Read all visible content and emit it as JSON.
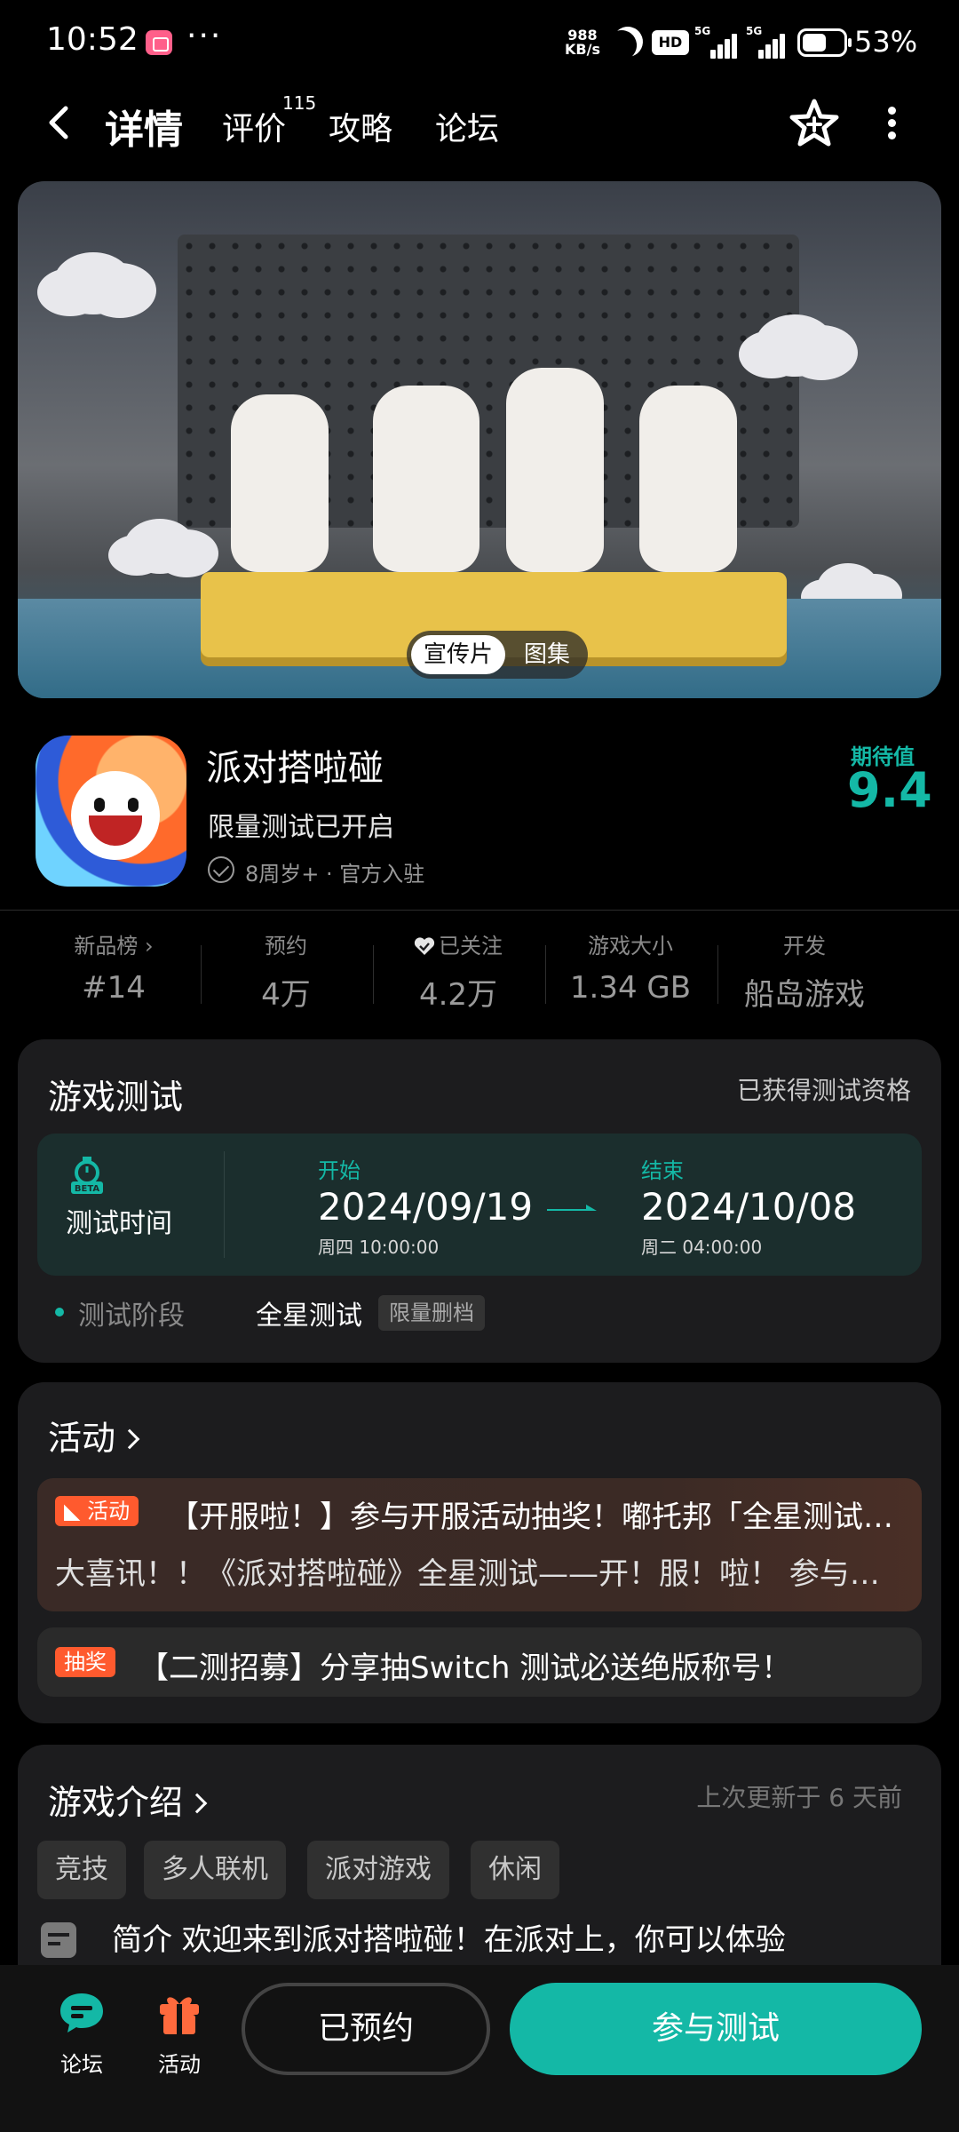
{
  "status_bar": {
    "time": "10:52",
    "dots": "···",
    "net_speed_value": "988",
    "net_speed_unit": "KB/s",
    "hd_label": "HD",
    "sim1_label": "5G",
    "sim2_label": "5G",
    "battery_percent": "53%"
  },
  "nav": {
    "tabs": [
      {
        "label": "详情"
      },
      {
        "label": "评价"
      },
      {
        "label": "攻略"
      },
      {
        "label": "论坛"
      }
    ],
    "review_count": "115"
  },
  "media": {
    "options": [
      "宣传片",
      "图集"
    ]
  },
  "game": {
    "title": "派对搭啦碰",
    "status": "限量测试已开启",
    "meta": "8周岁+ · 官方入驻",
    "expect_label": "期待值",
    "expect_value": "9.4"
  },
  "stats": [
    {
      "label": "新品榜 ›",
      "value": "#14"
    },
    {
      "label": "预约",
      "value": "4万"
    },
    {
      "label": "已关注",
      "value": "4.2万"
    },
    {
      "label": "游戏大小",
      "value": "1.34 GB"
    },
    {
      "label": "开发",
      "value": "船岛游戏"
    }
  ],
  "test_card": {
    "title": "游戏测试",
    "qualification": "已获得测试资格",
    "time_label": "测试时间",
    "beta_label": "BETA",
    "start_label": "开始",
    "start_date": "2024/09/19",
    "start_time": "周四 10:00:00",
    "end_label": "结束",
    "end_date": "2024/10/08",
    "end_time": "周二 04:00:00",
    "stage_label": "测试阶段",
    "stage_value": "全星测试",
    "stage_tag": "限量删档"
  },
  "activity_card": {
    "title": "活动",
    "items": [
      {
        "tag": "活动",
        "title": "【开服啦！】参与开服活动抽奖！嘟托邦「全星测试」开启...",
        "desc": "大喜讯！！《派对搭啦碰》全星测试——开！服！啦！ 参与开服活动..."
      },
      {
        "tag": "抽奖",
        "title": "【二测招募】分享抽Switch 测试必送绝版称号！"
      }
    ]
  },
  "intro_card": {
    "title": "游戏介绍",
    "updated": "上次更新于 6 天前",
    "tags": [
      "竞技",
      "多人联机",
      "派对游戏",
      "休闲"
    ],
    "intro_text": "简介 欢迎来到派对搭啦碰！在派对上，你可以体验"
  },
  "bottom_bar": {
    "forum_label": "论坛",
    "activity_label": "活动",
    "reserved_label": "已预约",
    "join_label": "参与测试"
  },
  "colors": {
    "accent": "#14b8a6",
    "background": "#000000",
    "card": "#1c1c1e",
    "activity_tag": "#ff5a2e"
  }
}
